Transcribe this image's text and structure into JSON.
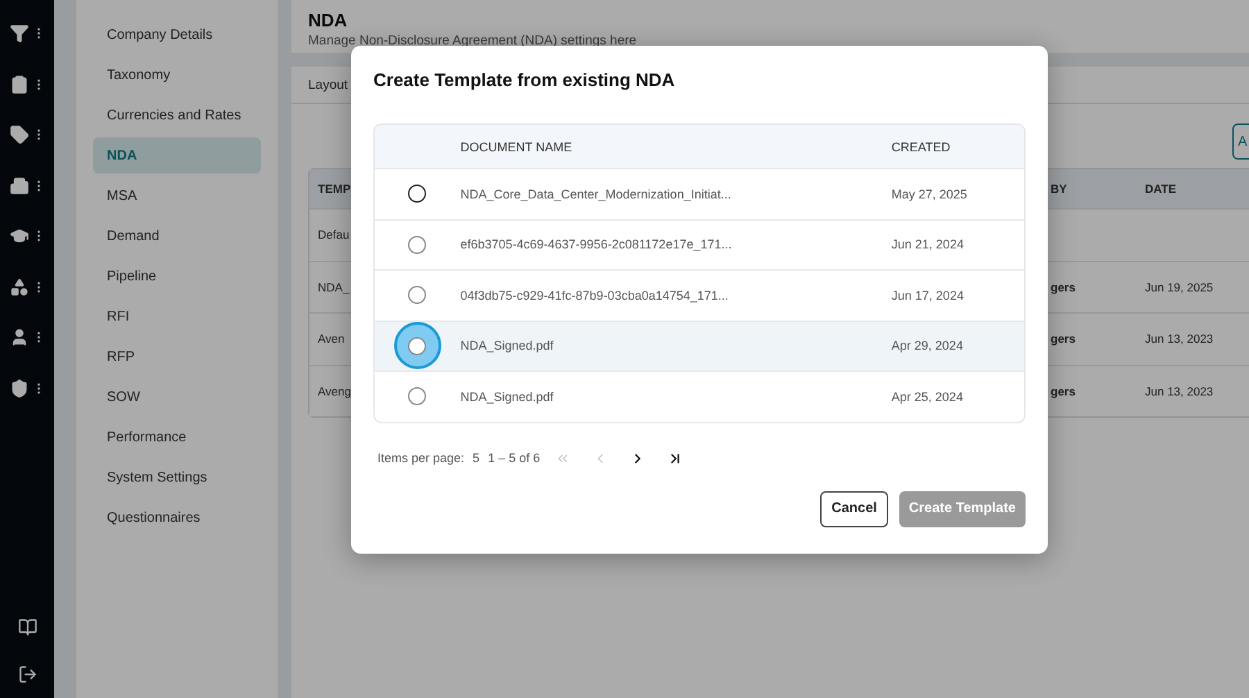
{
  "nav_rail": {
    "items": [
      {
        "kind": "filter"
      },
      {
        "kind": "clipboard"
      },
      {
        "kind": "tag"
      },
      {
        "kind": "building"
      },
      {
        "kind": "graduation"
      },
      {
        "kind": "shapes"
      },
      {
        "kind": "user"
      },
      {
        "kind": "shield"
      }
    ],
    "bottom": [
      {
        "kind": "book"
      },
      {
        "kind": "logout"
      }
    ]
  },
  "settings_menu": {
    "items": [
      {
        "label": "Company Details",
        "selected": false
      },
      {
        "label": "Taxonomy",
        "selected": false
      },
      {
        "label": "Currencies and Rates",
        "selected": false
      },
      {
        "label": "NDA",
        "selected": true
      },
      {
        "label": "MSA",
        "selected": false
      },
      {
        "label": "Demand",
        "selected": false
      },
      {
        "label": "Pipeline",
        "selected": false
      },
      {
        "label": "RFI",
        "selected": false
      },
      {
        "label": "RFP",
        "selected": false
      },
      {
        "label": "SOW",
        "selected": false
      },
      {
        "label": "Performance",
        "selected": false
      },
      {
        "label": "System Settings",
        "selected": false
      },
      {
        "label": "Questionnaires",
        "selected": false
      }
    ]
  },
  "page_header": {
    "title": "NDA",
    "subtitle": "Manage Non-Disclosure Agreement (NDA) settings here"
  },
  "tabs": [
    {
      "label": "Layout"
    }
  ],
  "add_button": {
    "label": "A"
  },
  "background_table": {
    "columns": [
      "TEMP",
      "BY",
      "DATE"
    ],
    "rows": [
      {
        "cells": [
          "Defau",
          "",
          ""
        ]
      },
      {
        "cells": [
          "NDA_",
          "gers",
          "Jun 19, 2025"
        ]
      },
      {
        "cells": [
          "Aven",
          "gers",
          "Jun 13, 2023"
        ]
      },
      {
        "cells": [
          "Aveng",
          "gers",
          "Jun 13, 2023"
        ]
      }
    ]
  },
  "dialog": {
    "title": "Create Template from existing NDA",
    "columns": [
      "DOCUMENT NAME",
      "CREATED"
    ],
    "rows": [
      {
        "name": "NDA_Core_Data_Center_Modernization_Initiat...",
        "created": "May 27, 2025",
        "selected": false,
        "hovered": false
      },
      {
        "name": "ef6b3705-4c69-4637-9956-2c081172e17e_171...",
        "created": "Jun 21, 2024",
        "selected": false,
        "hovered": false
      },
      {
        "name": "04f3db75-c929-41fc-87b9-03cba0a14754_171...",
        "created": "Jun 17, 2024",
        "selected": false,
        "hovered": false
      },
      {
        "name": "NDA_Signed.pdf",
        "created": "Apr 29, 2024",
        "selected": false,
        "hovered": true
      },
      {
        "name": "NDA_Signed.pdf",
        "created": "Apr 25, 2024",
        "selected": false,
        "hovered": false
      }
    ],
    "pagination": {
      "label": "Items per page:",
      "page_size": "5",
      "range": "1 – 5 of 6",
      "first_disabled": true,
      "prev_disabled": true,
      "next_disabled": false,
      "last_disabled": false
    },
    "buttons": [
      {
        "label": "Cancel",
        "kind": "secondary"
      },
      {
        "label": "Create Template",
        "kind": "primary",
        "disabled": true
      }
    ]
  }
}
